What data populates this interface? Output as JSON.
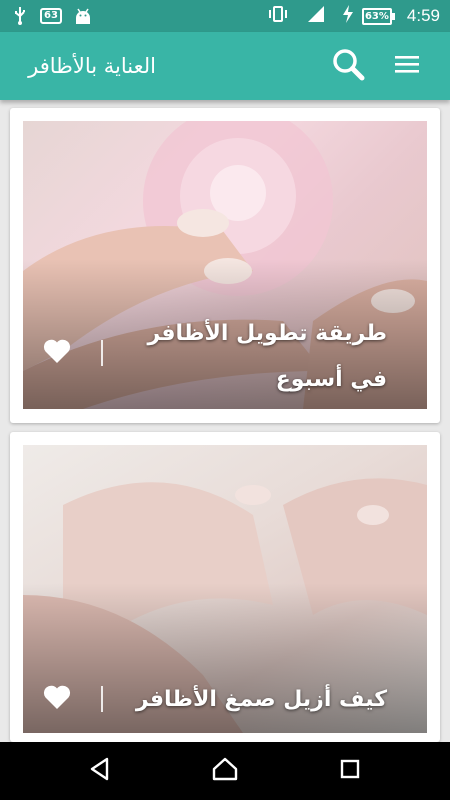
{
  "status_bar": {
    "notification_badge": "63",
    "battery_percent": "63%",
    "time": "4:59"
  },
  "app_bar": {
    "title": "العناية بالأظافر"
  },
  "articles": [
    {
      "title": "طريقة تطويل الأظافر في أسبوع"
    },
    {
      "title": "كيف أزيل صمغ الأظافر"
    }
  ]
}
